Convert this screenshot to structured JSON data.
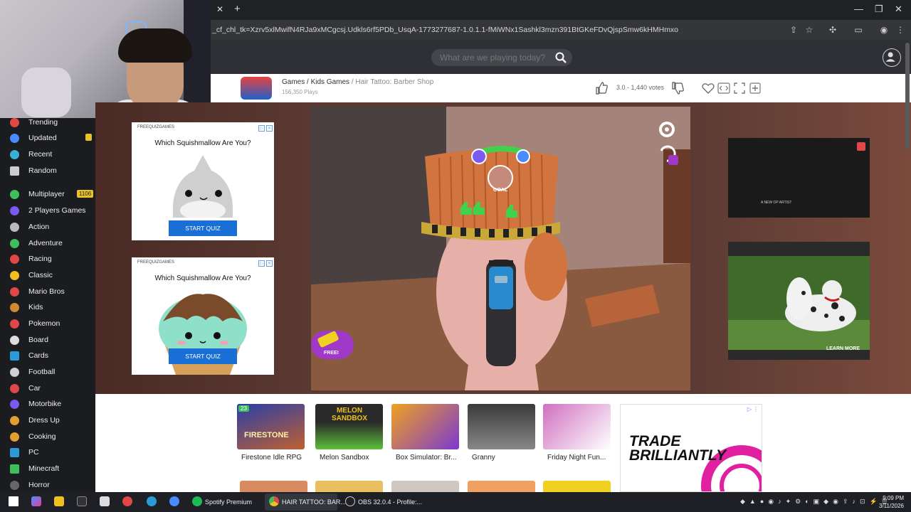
{
  "browser": {
    "url": "_cf_chl_tk=Xzrv5xlMwifN4RJa9xMCgcsj.Udkls6rf5PDb_UsqA-1773277687-1.0.1.1-fMiWNx1Sashkl3mzn391BtGKeFDvQjspSmw6kHMHmxo"
  },
  "header": {
    "search_placeholder": "What are we playing today?"
  },
  "game_info": {
    "breadcrumb_games": "Games",
    "breadcrumb_sep1": " / ",
    "breadcrumb_category": "Kids Games",
    "breadcrumb_sep2": " / ",
    "breadcrumb_current": "Hair Tattoo: Barber Shop",
    "plays": "156,350 Plays",
    "rating_votes": "3.0 - 1,440 votes"
  },
  "sidebar": {
    "items": [
      {
        "label": "Trending",
        "color": "#e04848"
      },
      {
        "label": "Updated",
        "color": "#4a8cff",
        "badge": " "
      },
      {
        "label": "Recent",
        "color": "#3ab0d8"
      },
      {
        "label": "Random",
        "color": "#cccccc"
      },
      {
        "label": "Multiplayer",
        "color": "#3fbf5a",
        "badge": "1106"
      },
      {
        "label": "2 Players Games",
        "color": "#7a5af0"
      },
      {
        "label": "Action",
        "color": "#bbbbbb"
      },
      {
        "label": "Adventure",
        "color": "#3fbf5a"
      },
      {
        "label": "Racing",
        "color": "#e04848"
      },
      {
        "label": "Classic",
        "color": "#f0c020"
      },
      {
        "label": "Mario Bros",
        "color": "#e04848"
      },
      {
        "label": "Kids",
        "color": "#d08a30"
      },
      {
        "label": "Pokemon",
        "color": "#e04848"
      },
      {
        "label": "Board",
        "color": "#dddddd"
      },
      {
        "label": "Cards",
        "color": "#2a9ad8"
      },
      {
        "label": "Football",
        "color": "#cfcfcf"
      },
      {
        "label": "Car",
        "color": "#e04848"
      },
      {
        "label": "Motorbike",
        "color": "#7a5af0"
      },
      {
        "label": "Dress Up",
        "color": "#e0a030"
      },
      {
        "label": "Cooking",
        "color": "#e0a030"
      },
      {
        "label": "PC",
        "color": "#2a9ad8"
      },
      {
        "label": "Minecraft",
        "color": "#3fbf5a"
      },
      {
        "label": "Horror",
        "color": "#666666"
      }
    ]
  },
  "ads": {
    "left1": {
      "brand": "FREEQUIZGAMES",
      "title": "Which Squishmallow Are You?",
      "button": "START QUIZ"
    },
    "left2": {
      "brand": "FREEQUIZGAMES",
      "title": "Which Squishmallow Are You?",
      "button": "START QUIZ"
    },
    "video_caption": "A NEW OP ARTIST",
    "dog_cta": "LEARN MORE",
    "trade_line1": "TRADE",
    "trade_line2": "BRILLIANTLY"
  },
  "game": {
    "goal_label": "GOAL",
    "free_label": "FREE!"
  },
  "bottom_games": [
    {
      "label": "Firestone Idle RPG",
      "badge": "23",
      "art": "FIRESTONE",
      "colorA": "#2a3ea8",
      "colorB": "#c06030"
    },
    {
      "label": "Melon Sandbox",
      "art": "MELON SANDBOX",
      "colorA": "#2a2a2a",
      "colorB": "#5cbf3a"
    },
    {
      "label": "Box Simulator: Br...",
      "colorA": "#f0a020",
      "colorB": "#7a3ad0"
    },
    {
      "label": "Granny",
      "colorA": "#3a3a3a",
      "colorB": "#888888"
    },
    {
      "label": "Friday Night Fun...",
      "colorA": "#d070c0",
      "colorB": "#ffffff"
    }
  ],
  "taskbar": {
    "apps": [
      {
        "label": "Spotify Premium"
      },
      {
        "label": "HAIR TATTOO: BAR..."
      },
      {
        "label": "OBS 32.0.4 - Profile:..."
      }
    ],
    "time": "9:09 PM",
    "date": "3/11/2026"
  }
}
